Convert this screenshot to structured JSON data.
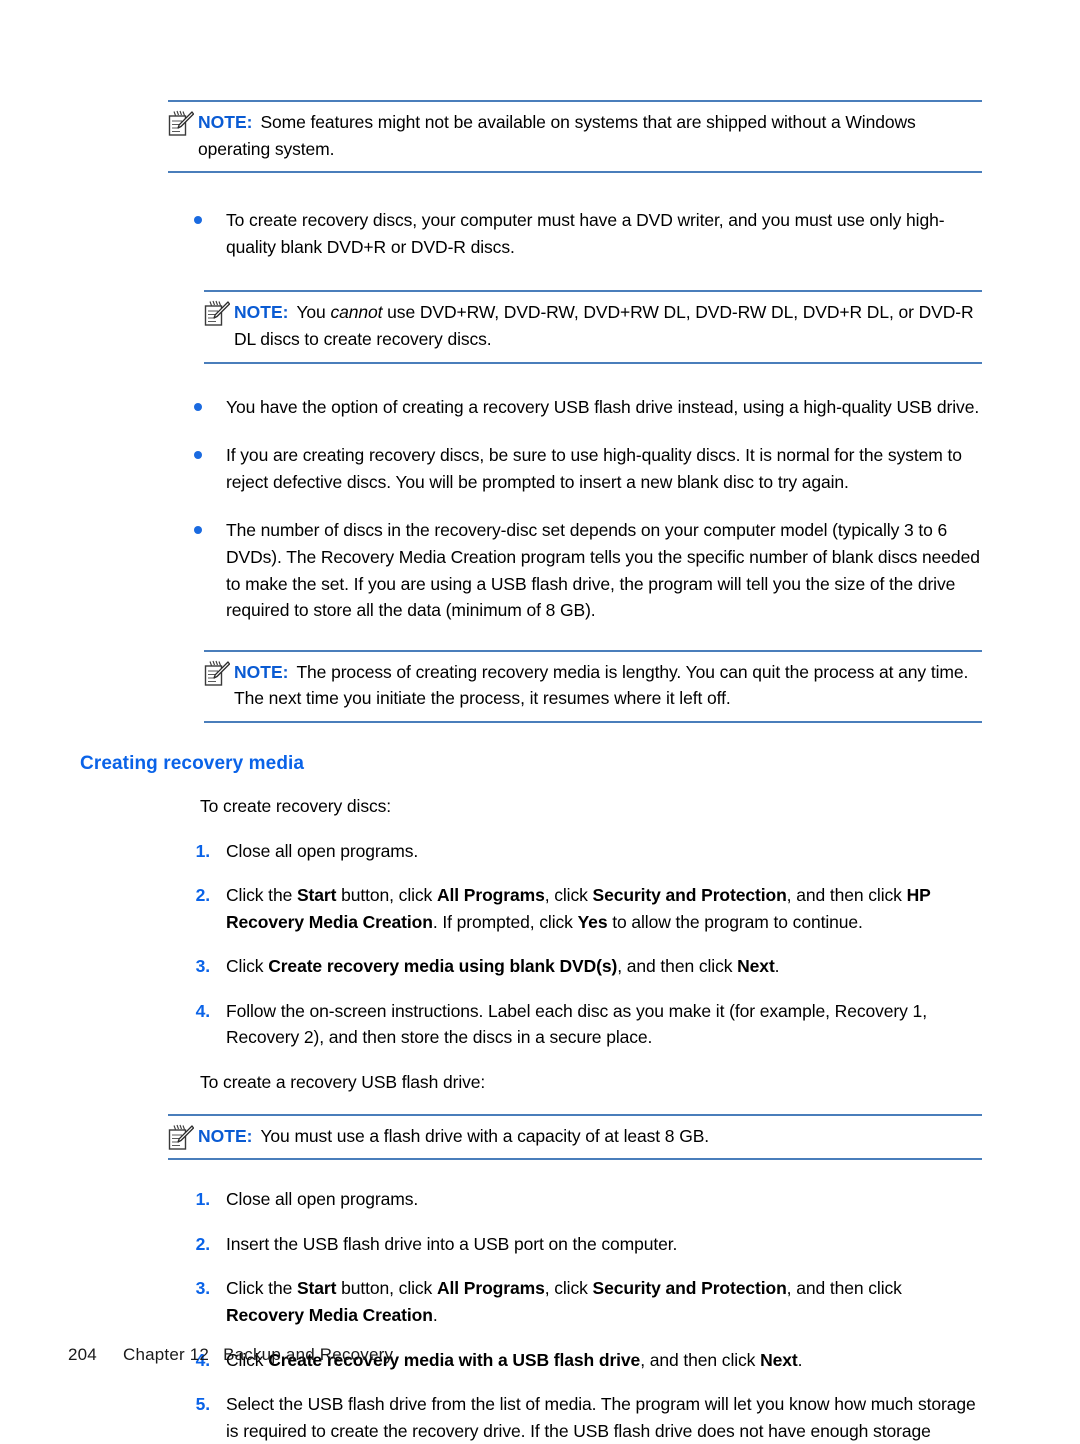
{
  "document": {
    "note_label": "NOTE:",
    "note_icon": "note-pencil-icon",
    "accent_blue": "#0a63e8",
    "rule_blue": "#4a7ebb",
    "bullet_blue": "#1a6ae0"
  },
  "notes": {
    "note1": "Some features might not be available on systems that are shipped without a Windows operating system.",
    "note2_pre": "You ",
    "note2_em": "cannot",
    "note2_post": " use DVD+RW, DVD-RW, DVD+RW DL, DVD-RW DL, DVD+R DL, or DVD-R DL discs to create recovery discs.",
    "note3": "The process of creating recovery media is lengthy. You can quit the process at any time. The next time you initiate the process, it resumes where it left off.",
    "note4": "You must use a flash drive with a capacity of at least 8 GB."
  },
  "bullets": [
    "To create recovery discs, your computer must have a DVD writer, and you must use only high-quality blank DVD+R or DVD-R discs.",
    "You have the option of creating a recovery USB flash drive instead, using a high-quality USB drive.",
    "If you are creating recovery discs, be sure to use high-quality discs. It is normal for the system to reject defective discs. You will be prompted to insert a new blank disc to try again.",
    "The number of discs in the recovery-disc set depends on your computer model (typically 3 to 6 DVDs). The Recovery Media Creation program tells you the specific number of blank discs needed to make the set. If you are using a USB flash drive, the program will tell you the size of the drive required to store all the data (minimum of 8 GB)."
  ],
  "section": {
    "heading": "Creating recovery media",
    "intro_discs": "To create recovery discs:",
    "intro_usb": "To create a recovery USB flash drive:"
  },
  "disc_steps": {
    "n1": "1.",
    "s1": "Close all open programs.",
    "n2": "2.",
    "s2_a": "Click the ",
    "s2_b1": "Start",
    "s2_c": " button, click ",
    "s2_b2": "All Programs",
    "s2_d": ", click ",
    "s2_b3": "Security and Protection",
    "s2_e": ", and then click ",
    "s2_b4": "HP Recovery Media Creation",
    "s2_f": ". If prompted, click ",
    "s2_b5": "Yes",
    "s2_g": " to allow the program to continue.",
    "n3": "3.",
    "s3_a": "Click ",
    "s3_b1": "Create recovery media using blank DVD(s)",
    "s3_c": ", and then click ",
    "s3_b2": "Next",
    "s3_d": ".",
    "n4": "4.",
    "s4": "Follow the on-screen instructions. Label each disc as you make it (for example, Recovery 1, Recovery 2), and then store the discs in a secure place."
  },
  "usb_steps": {
    "n1": "1.",
    "s1": "Close all open programs.",
    "n2": "2.",
    "s2": "Insert the USB flash drive into a USB port on the computer.",
    "n3": "3.",
    "s3_a": "Click the ",
    "s3_b1": "Start",
    "s3_c": " button, click ",
    "s3_b2": "All Programs",
    "s3_d": ", click ",
    "s3_b3": "Security and Protection",
    "s3_e": ", and then click ",
    "s3_b4": "Recovery Media Creation",
    "s3_f": ".",
    "n4": "4.",
    "s4_a": "Click ",
    "s4_b1": "Create recovery media with a USB flash drive",
    "s4_c": ", and then click ",
    "s4_b2": "Next",
    "s4_d": ".",
    "n5": "5.",
    "s5": "Select the USB flash drive from the list of media. The program will let you know how much storage is required to create the recovery drive. If the USB flash drive does not have enough storage"
  },
  "footer": {
    "page_number": "204",
    "chapter": "Chapter 12",
    "title": "Backup and Recovery"
  }
}
